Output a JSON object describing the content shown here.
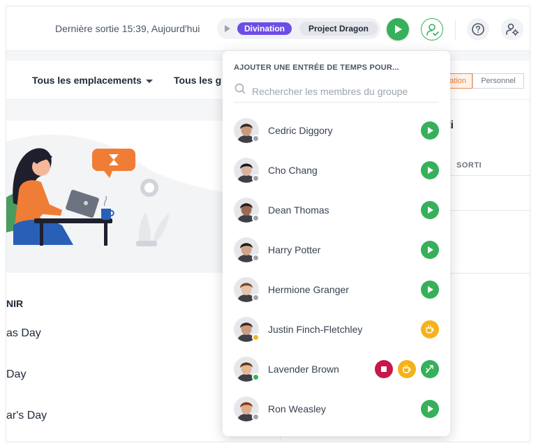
{
  "header": {
    "last_out": "Dernière sortie 15:39, Aujourd'hui",
    "activity": "Divination",
    "project": "Project Dragon"
  },
  "filters": {
    "locations": "Tous les emplacements",
    "groups": "Tous les g",
    "scope_org": "sation",
    "scope_personal": "Personnel"
  },
  "left_panel": {
    "upcoming_title": "NIR",
    "holidays": [
      "as Day",
      "Day",
      "ar's Day"
    ]
  },
  "right_panel": {
    "title": "rti",
    "column": "SORTI"
  },
  "dropdown": {
    "title": "AJOUTER UNE ENTRÉE DE TEMPS POUR...",
    "search_placeholder": "Rechercher les membres du groupe",
    "members": [
      {
        "name": "Cedric Diggory",
        "status": "offline",
        "actions": [
          "play"
        ]
      },
      {
        "name": "Cho Chang",
        "status": "offline",
        "actions": [
          "play"
        ]
      },
      {
        "name": "Dean Thomas",
        "status": "offline",
        "actions": [
          "play"
        ]
      },
      {
        "name": "Harry Potter",
        "status": "offline",
        "actions": [
          "play"
        ]
      },
      {
        "name": "Hermione Granger",
        "status": "offline",
        "actions": [
          "play"
        ]
      },
      {
        "name": "Justin Finch-Fletchley",
        "status": "on-break",
        "actions": [
          "break"
        ]
      },
      {
        "name": "Lavender Brown",
        "status": "working",
        "actions": [
          "stop",
          "break",
          "switch"
        ]
      },
      {
        "name": "Ron Weasley",
        "status": "offline",
        "actions": [
          "play"
        ]
      }
    ]
  },
  "colors": {
    "accent_green": "#36b05a",
    "activity_purple": "#6d4de6",
    "break_yellow": "#f5b21a",
    "stop_red": "#c8174b",
    "offline_gray": "#9ca3af"
  }
}
